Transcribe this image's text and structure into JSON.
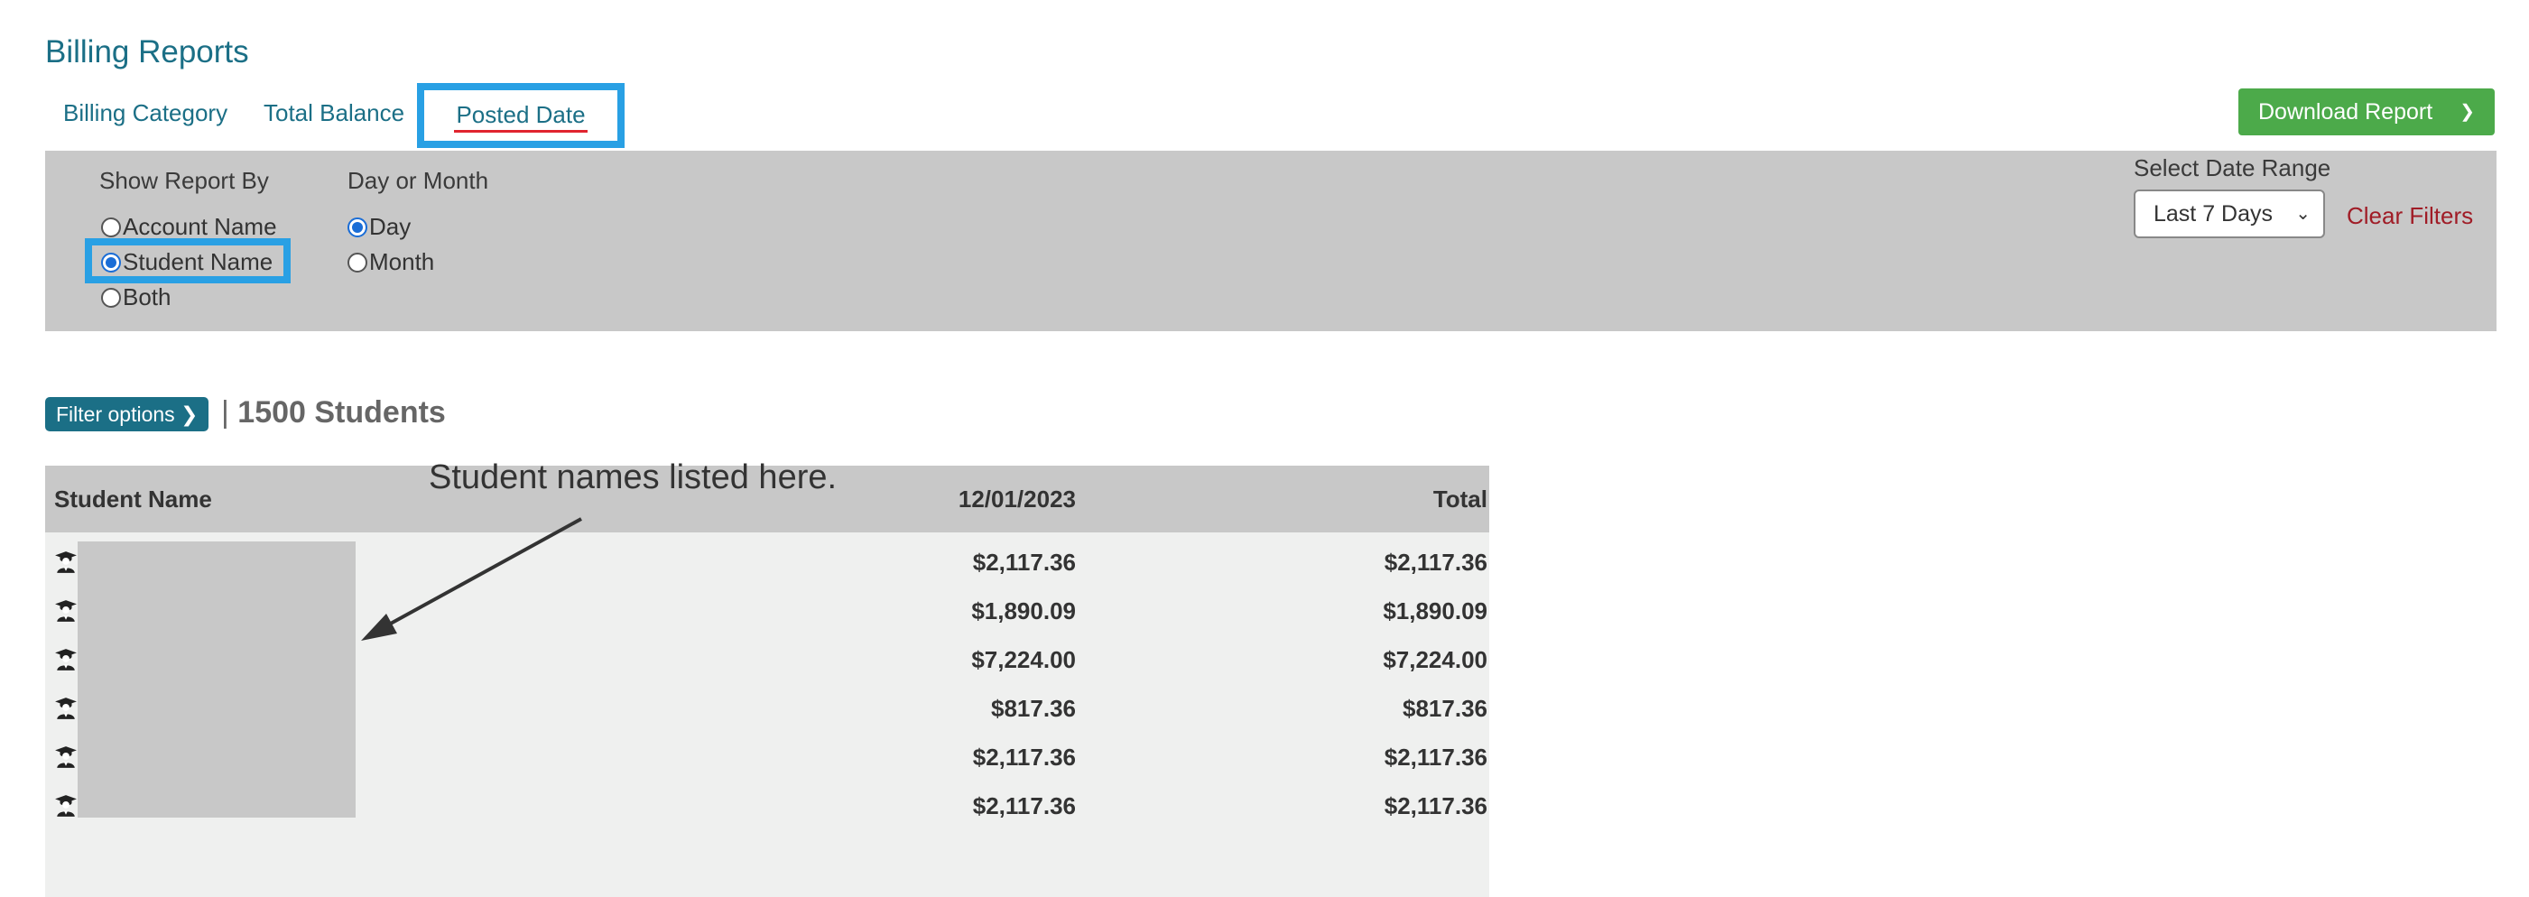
{
  "page_title": "Billing Reports",
  "tabs": [
    {
      "label": "Billing Category"
    },
    {
      "label": "Total Balance"
    },
    {
      "label": "Posted Date",
      "active": true
    }
  ],
  "download_button": {
    "label": "Download Report",
    "icon": "chevron-down-icon",
    "color": "#4caa4a"
  },
  "filters": {
    "show_report_by": {
      "label": "Show Report By",
      "options": [
        "Account Name",
        "Student Name",
        "Both"
      ],
      "selected": "Student Name"
    },
    "day_or_month": {
      "label": "Day or Month",
      "options": [
        "Day",
        "Month"
      ],
      "selected": "Day"
    },
    "date_range": {
      "label": "Select Date Range",
      "value": "Last 7 Days"
    },
    "clear_label": "Clear Filters"
  },
  "filter_options_button": {
    "label": "Filter options",
    "icon": "chevron-right-icon"
  },
  "student_count": {
    "separator": "|",
    "text": "1500 Students"
  },
  "table": {
    "headers": [
      "Student Name",
      "12/01/2023",
      "Total"
    ],
    "row_icon": "student-icon",
    "rows": [
      {
        "date_value": "$2,117.36",
        "total": "$2,117.36"
      },
      {
        "date_value": "$1,890.09",
        "total": "$1,890.09"
      },
      {
        "date_value": "$7,224.00",
        "total": "$7,224.00"
      },
      {
        "date_value": "$817.36",
        "total": "$817.36"
      },
      {
        "date_value": "$2,117.36",
        "total": "$2,117.36"
      },
      {
        "date_value": "$2,117.36",
        "total": "$2,117.36"
      }
    ]
  },
  "annotation": "Student names listed here.",
  "colors": {
    "accent": "#1b6f86",
    "highlight": "#29a0e4",
    "danger": "#a01c26",
    "panel": "#c8c8c8"
  }
}
